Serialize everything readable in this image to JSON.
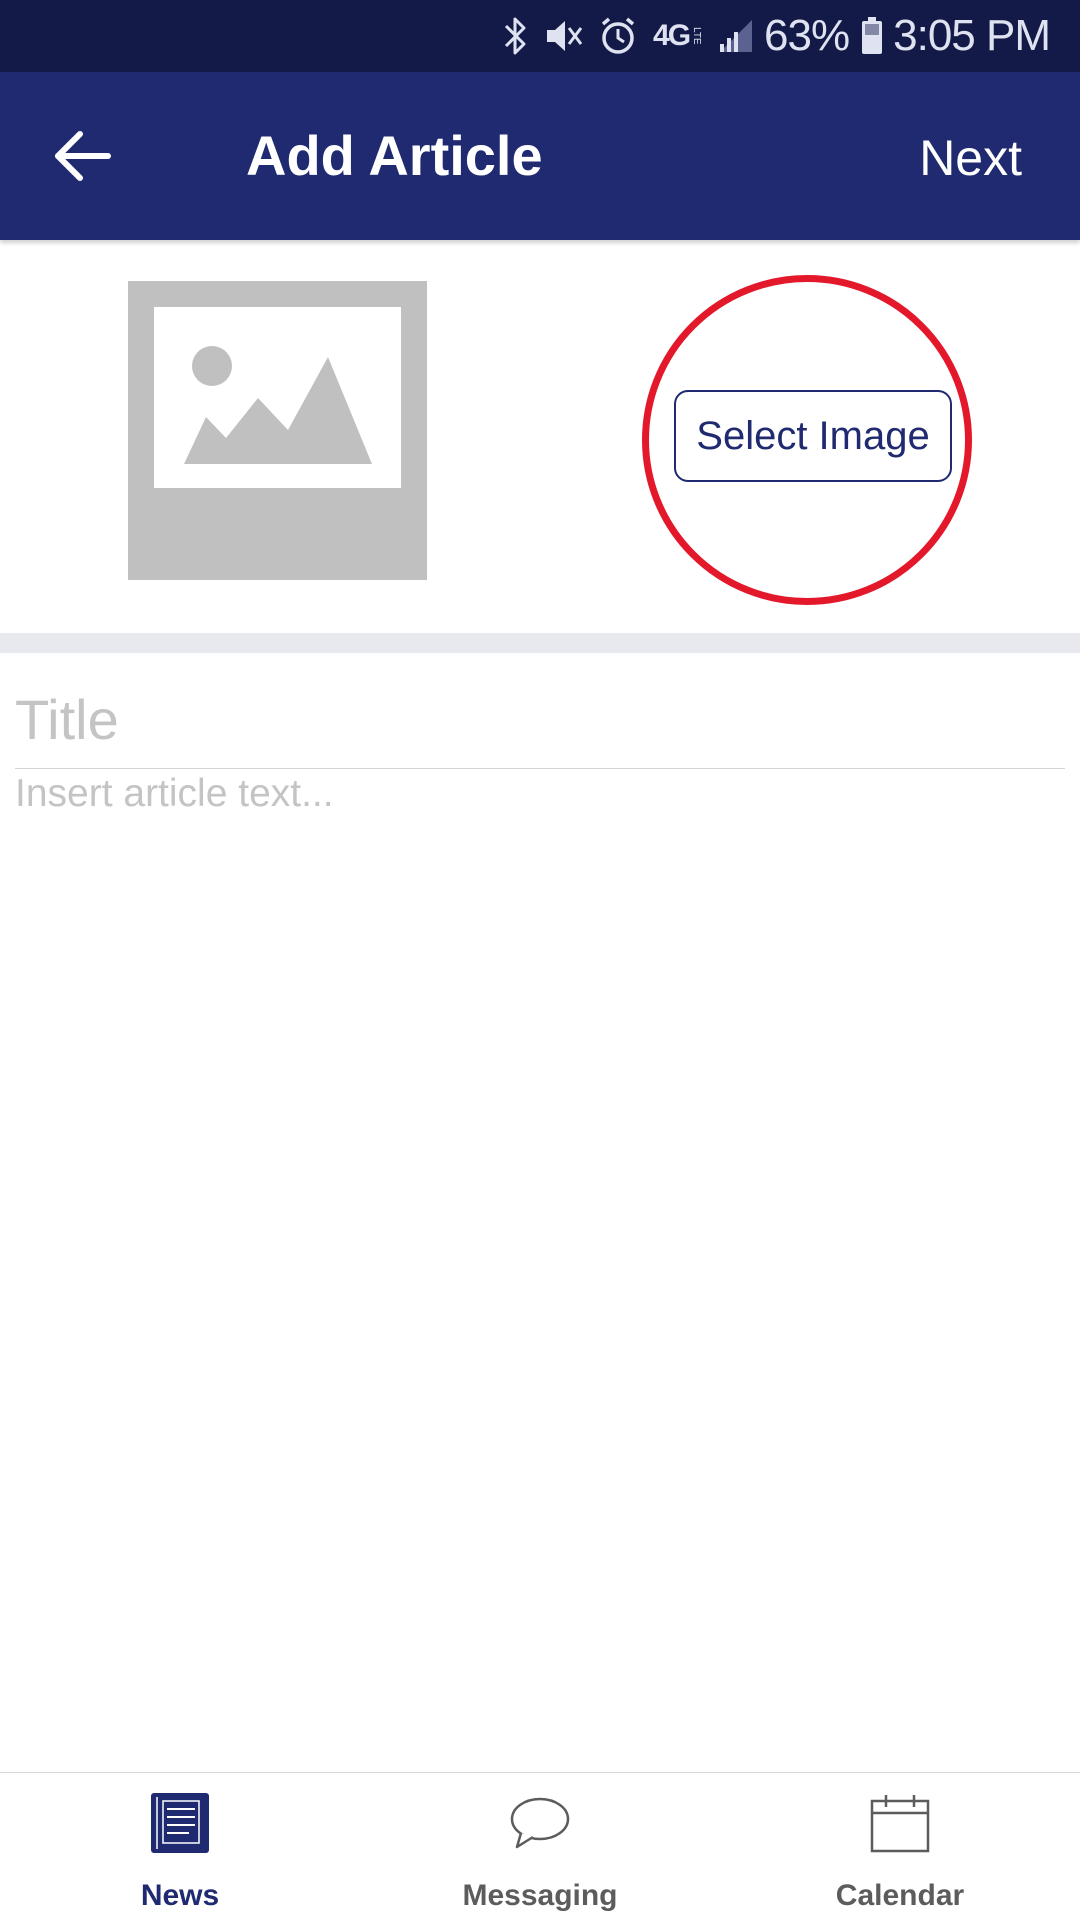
{
  "status_bar": {
    "battery": "63%",
    "time": "3:05 PM",
    "network": "4G",
    "network_sub": "LTE",
    "icons": [
      "bluetooth-icon",
      "vibrate-icon",
      "alarm-icon",
      "network-4g-lte-icon",
      "signal-icon",
      "battery-icon"
    ]
  },
  "app_bar": {
    "title": "Add Article",
    "next_label": "Next",
    "back_icon": "arrow-left-icon",
    "background": "#1f2a70"
  },
  "image_section": {
    "placeholder_icon": "image-placeholder-icon",
    "select_image_label": "Select Image",
    "highlight_color": "#e3182a"
  },
  "form": {
    "title_placeholder": "Title",
    "body_placeholder": "Insert article text..."
  },
  "bottom_nav": {
    "items": [
      {
        "label": "News",
        "icon": "news-icon",
        "active": true
      },
      {
        "label": "Messaging",
        "icon": "chat-bubble-icon",
        "active": false
      },
      {
        "label": "Calendar",
        "icon": "calendar-icon",
        "active": false
      }
    ],
    "active_color": "#1f2a70",
    "inactive_color": "#5c5c5c"
  }
}
